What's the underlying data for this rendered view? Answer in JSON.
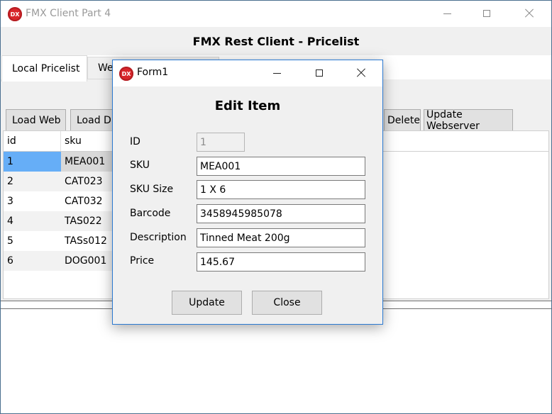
{
  "main_window": {
    "title": "FMX Client Part 4",
    "app_icon_text": "DX",
    "heading": "FMX Rest Client - Pricelist",
    "tabs": [
      {
        "label": "Local Pricelist",
        "active": true
      },
      {
        "label": "Web",
        "active": false
      }
    ],
    "toolbar": {
      "load_web": "Load Web",
      "load_db": "Load DB",
      "delete": "Delete",
      "update_webserver": "Update Webserver"
    },
    "grid": {
      "columns": [
        "id",
        "sku"
      ],
      "rows": [
        {
          "id": "1",
          "sku": "MEA001",
          "selected": true
        },
        {
          "id": "2",
          "sku": "CAT023"
        },
        {
          "id": "3",
          "sku": "CAT032"
        },
        {
          "id": "4",
          "sku": "TAS022"
        },
        {
          "id": "5",
          "sku": "TASs012"
        },
        {
          "id": "6",
          "sku": "DOG001"
        }
      ]
    }
  },
  "dialog": {
    "title": "Form1",
    "app_icon_text": "DX",
    "heading": "Edit Item",
    "fields": {
      "id": {
        "label": "ID",
        "value": "1"
      },
      "sku": {
        "label": "SKU",
        "value": "MEA001"
      },
      "sku_size": {
        "label": "SKU Size",
        "value": "1 X 6"
      },
      "barcode": {
        "label": "Barcode",
        "value": "3458945985078"
      },
      "description": {
        "label": "Description",
        "value": "Tinned Meat 200g"
      },
      "price": {
        "label": "Price",
        "value": "145.67"
      }
    },
    "buttons": {
      "update": "Update",
      "close": "Close"
    }
  },
  "colors": {
    "selection": "#66aef7",
    "dialog_border": "#2b79d1",
    "app_icon": "#d8262b",
    "panel": "#f0f0f0",
    "button": "#e1e1e1"
  }
}
